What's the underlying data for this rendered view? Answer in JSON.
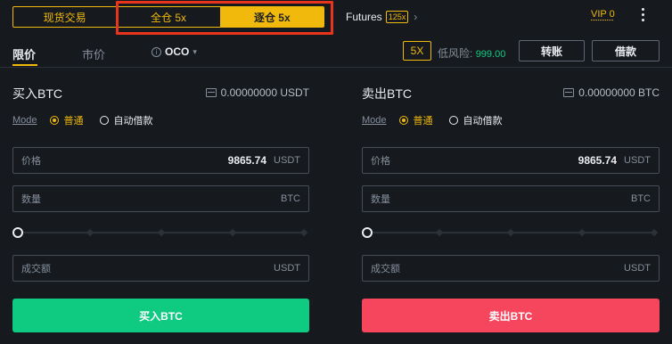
{
  "header": {
    "mode_tabs": [
      "现货交易",
      "全仓 5x",
      "逐仓 5x"
    ],
    "active_mode": 2,
    "futures_label": "Futures",
    "futures_leverage": "125x",
    "futures_chevron": "›",
    "vip_label": "VIP 0"
  },
  "order_tabs": {
    "limit": "限价",
    "market": "市价",
    "oco": "OCO",
    "leverage": "5X",
    "risk_label": "低风险:",
    "risk_value": "999.00",
    "transfer_btn": "转账",
    "borrow_btn": "借款"
  },
  "buy": {
    "title": "买入BTC",
    "balance": "0.00000000 USDT",
    "mode_label": "Mode",
    "opt_normal": "普通",
    "opt_auto": "自动借款",
    "price_label": "价格",
    "price_value": "9865.74",
    "price_unit": "USDT",
    "qty_label": "数量",
    "qty_unit": "BTC",
    "total_label": "成交额",
    "total_unit": "USDT",
    "slider_percent": 0,
    "submit": "买入BTC"
  },
  "sell": {
    "title": "卖出BTC",
    "balance": "0.00000000 BTC",
    "mode_label": "Mode",
    "opt_normal": "普通",
    "opt_auto": "自动借款",
    "price_label": "价格",
    "price_value": "9865.74",
    "price_unit": "USDT",
    "qty_label": "数量",
    "qty_unit": "BTC",
    "total_label": "成交额",
    "total_unit": "USDT",
    "slider_percent": 0,
    "submit": "卖出BTC"
  },
  "colors": {
    "accent": "#f0b90b",
    "buy": "#0ecb81",
    "sell": "#f6465d",
    "highlight_box": "#e8341c"
  }
}
